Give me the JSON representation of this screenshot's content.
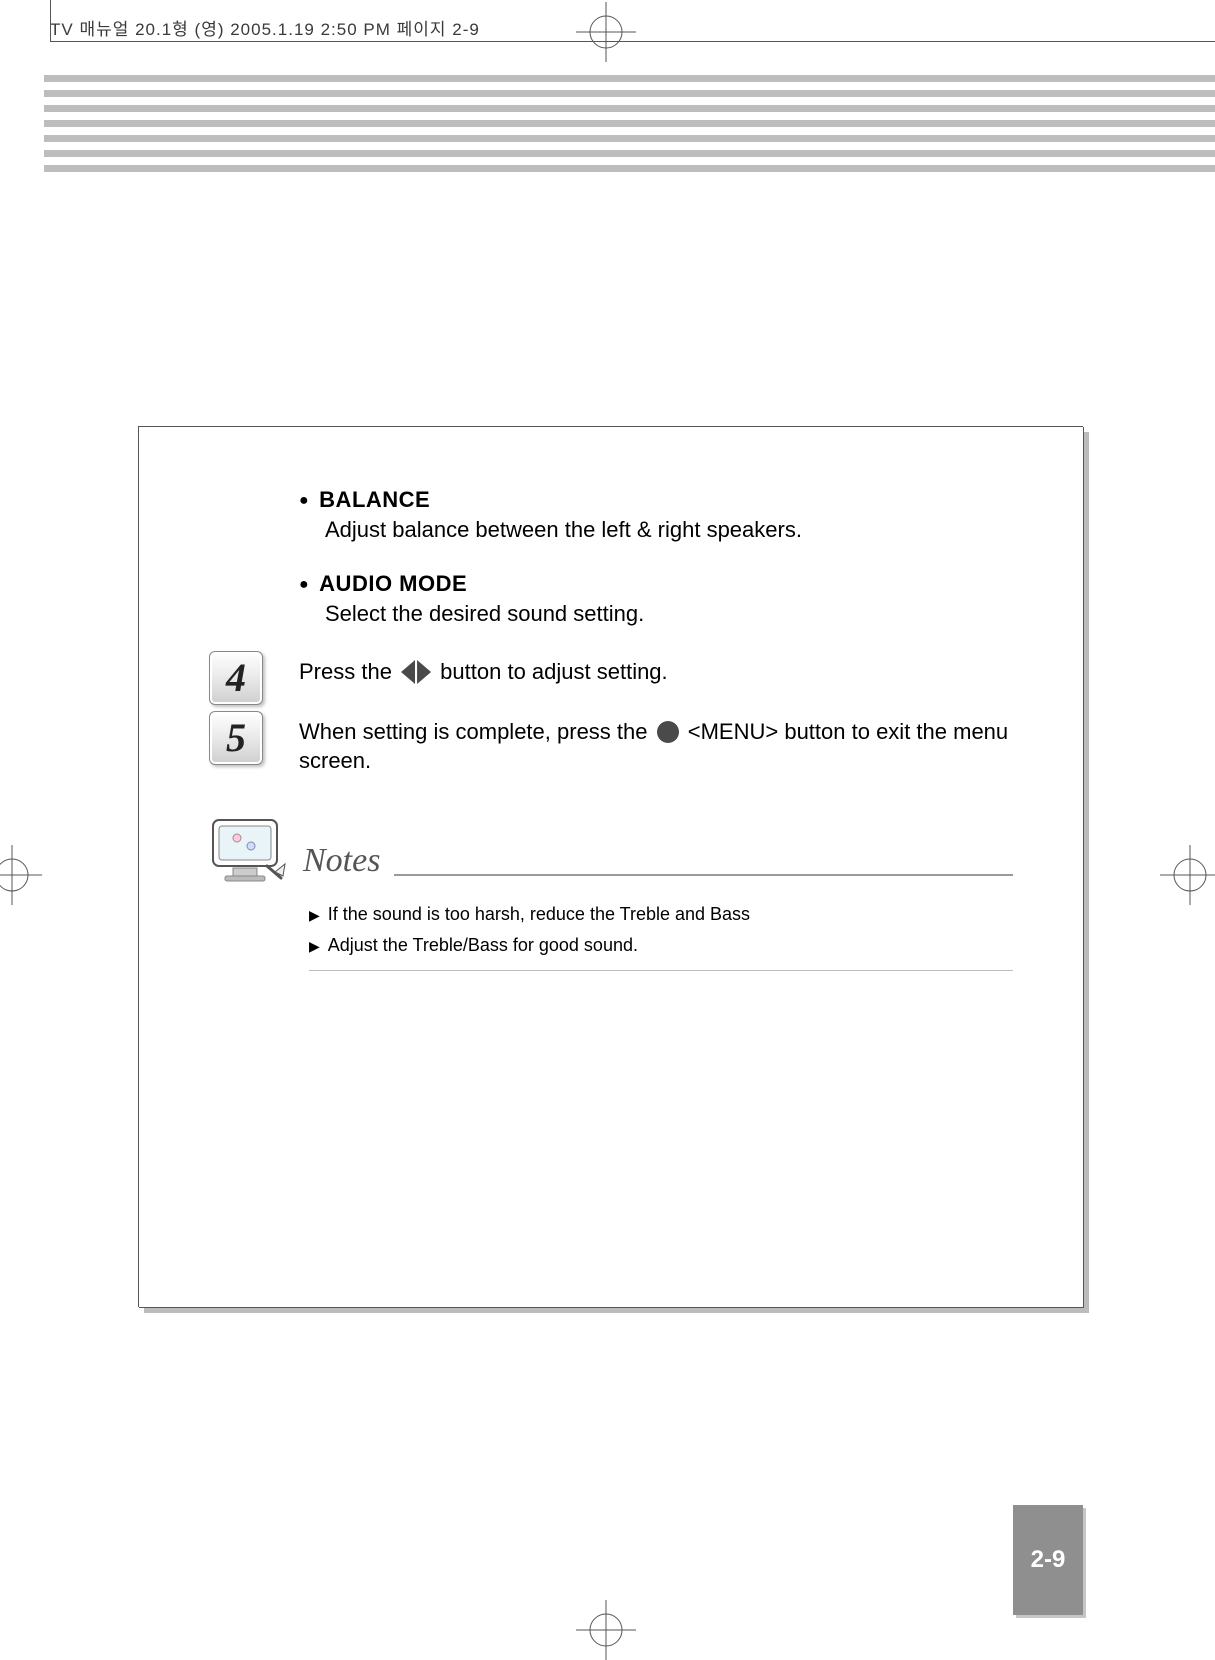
{
  "meta_header": "TV 매뉴얼 20.1형 (영)  2005.1.19 2:50 PM  페이지 2-9",
  "bullets": [
    {
      "title": "BALANCE",
      "desc": "Adjust balance between the left & right speakers."
    },
    {
      "title": "AUDIO MODE",
      "desc": "Select the desired sound setting."
    }
  ],
  "steps": {
    "s4": {
      "num": "4",
      "pre": "Press the ",
      "post": " button to adjust setting."
    },
    "s5": {
      "num": "5",
      "pre": "When setting is complete, press the ",
      "mid": " <MENU> button to exit the menu screen."
    }
  },
  "notes": {
    "title": "Notes",
    "lines": [
      "If the sound is too harsh, reduce the Treble and Bass",
      "Adjust the Treble/Bass for good sound."
    ]
  },
  "page_number": "2-9"
}
